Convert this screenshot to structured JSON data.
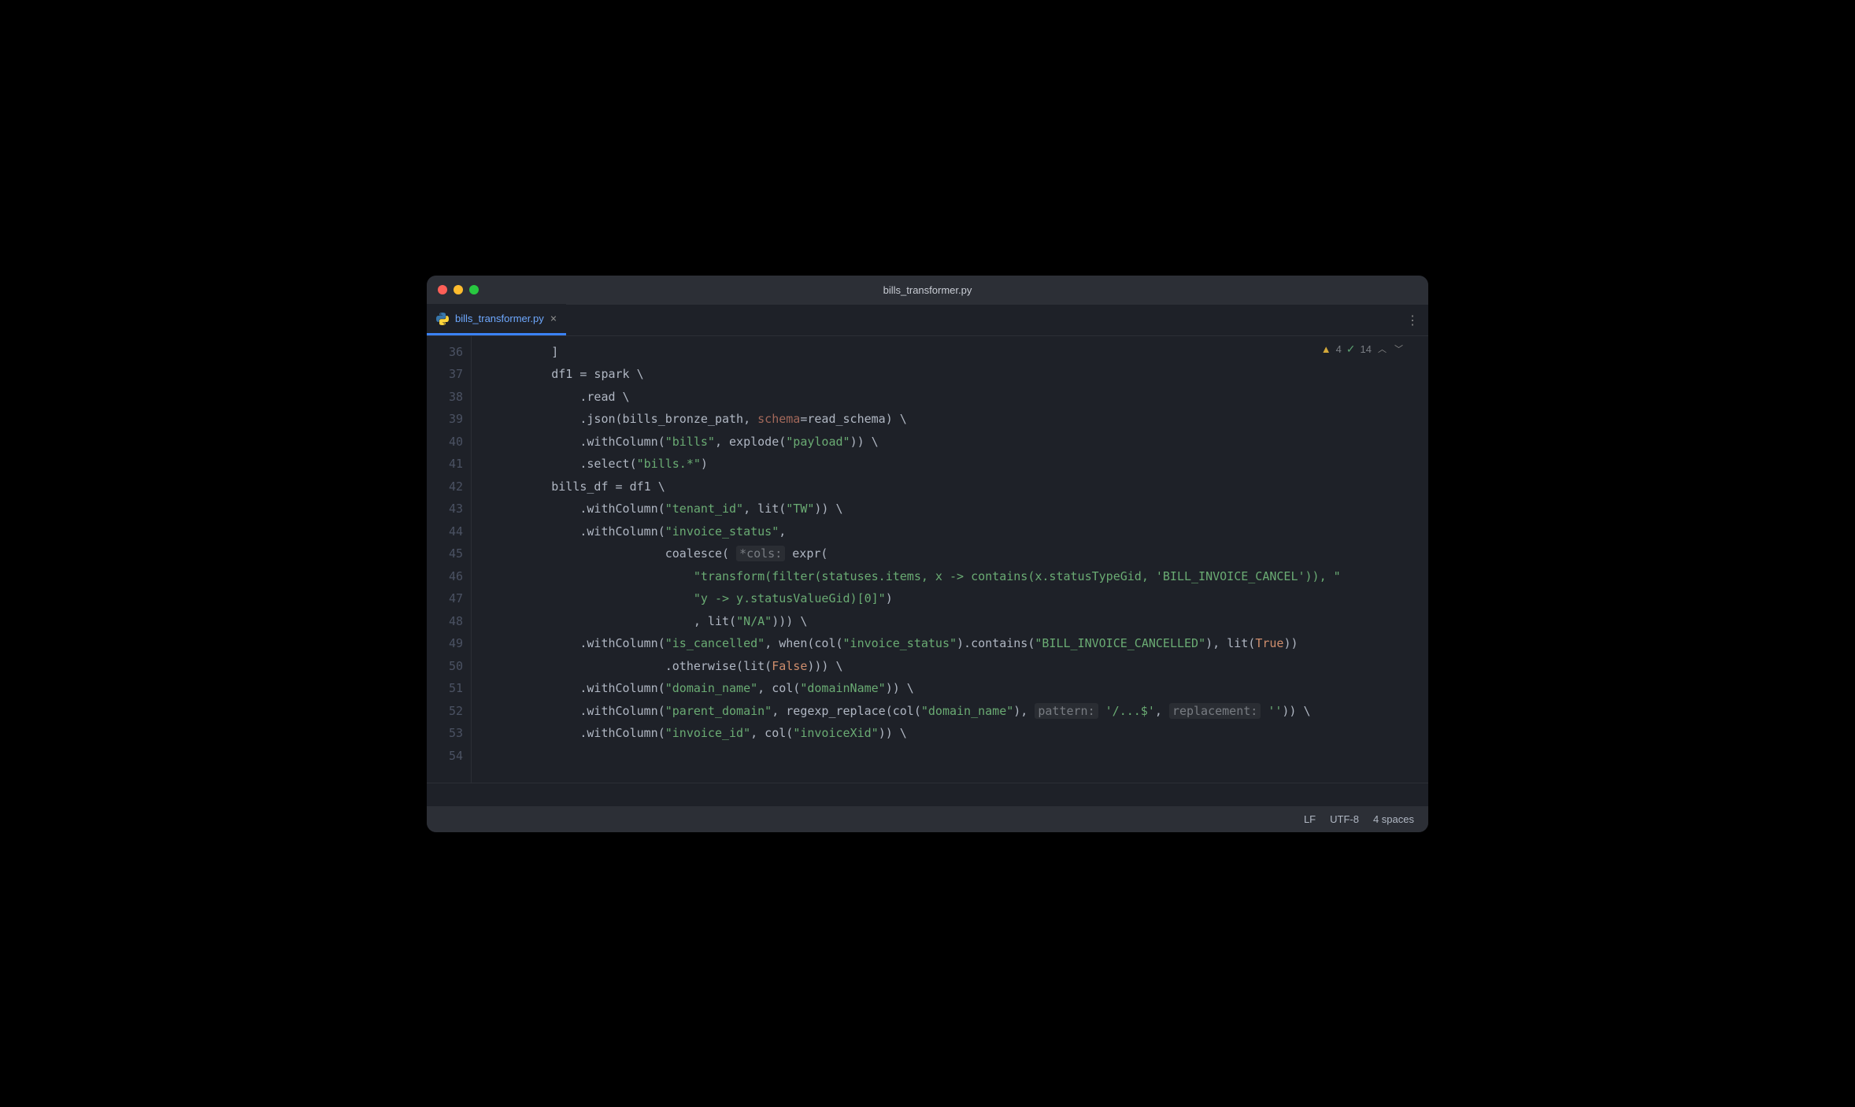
{
  "window": {
    "title": "bills_transformer.py"
  },
  "tab": {
    "label": "bills_transformer.py"
  },
  "inspection": {
    "warnings": "4",
    "weak": "14"
  },
  "statusbar": {
    "linesep": "LF",
    "encoding": "UTF-8",
    "indent": "4 spaces"
  },
  "gutter": [
    "36",
    "37",
    "38",
    "39",
    "40",
    "41",
    "42",
    "43",
    "44",
    "45",
    "46",
    "47",
    "48",
    "49",
    "50",
    "51",
    "52",
    "53",
    "54"
  ],
  "code": {
    "l36": {
      "indent": "        ",
      "tok": [
        {
          "t": "]",
          "c": "op"
        }
      ]
    },
    "l37": {
      "indent": "        ",
      "tok": [
        {
          "t": "df1 = spark \\",
          "c": "id"
        }
      ]
    },
    "l38": {
      "indent": "            ",
      "tok": [
        {
          "t": ".read \\",
          "c": "id"
        }
      ]
    },
    "l39": {
      "indent": "            ",
      "tok": [
        {
          "t": ".json(bills_bronze_path, ",
          "c": "id"
        },
        {
          "t": "schema",
          "c": "kwarg"
        },
        {
          "t": "=read_schema) \\",
          "c": "id"
        }
      ]
    },
    "l40": {
      "indent": "            ",
      "tok": [
        {
          "t": ".withColumn(",
          "c": "id"
        },
        {
          "t": "\"bills\"",
          "c": "str"
        },
        {
          "t": ", explode(",
          "c": "id"
        },
        {
          "t": "\"payload\"",
          "c": "str"
        },
        {
          "t": ")) \\",
          "c": "id"
        }
      ]
    },
    "l41": {
      "indent": "            ",
      "tok": [
        {
          "t": ".select(",
          "c": "id"
        },
        {
          "t": "\"bills.*\"",
          "c": "str"
        },
        {
          "t": ")",
          "c": "id"
        }
      ]
    },
    "l42": {
      "indent": "",
      "tok": []
    },
    "l43": {
      "indent": "        ",
      "tok": [
        {
          "t": "bills_df = df1 \\",
          "c": "id"
        }
      ]
    },
    "l44": {
      "indent": "            ",
      "tok": [
        {
          "t": ".withColumn(",
          "c": "id"
        },
        {
          "t": "\"tenant_id\"",
          "c": "str"
        },
        {
          "t": ", lit(",
          "c": "id"
        },
        {
          "t": "\"TW\"",
          "c": "str"
        },
        {
          "t": ")) \\",
          "c": "id"
        }
      ]
    },
    "l45": {
      "indent": "            ",
      "tok": [
        {
          "t": ".withColumn(",
          "c": "id"
        },
        {
          "t": "\"invoice_status\"",
          "c": "str"
        },
        {
          "t": ",",
          "c": "id"
        }
      ]
    },
    "l46": {
      "indent": "                        ",
      "tok": [
        {
          "t": "coalesce( ",
          "c": "id"
        },
        {
          "t": "*cols:",
          "c": "hint"
        },
        {
          "t": " expr(",
          "c": "id"
        }
      ]
    },
    "l47": {
      "indent": "                            ",
      "tok": [
        {
          "t": "\"transform(filter(statuses.items, x -> contains(x.statusTypeGid, 'BILL_INVOICE_CANCEL')), \"",
          "c": "str"
        }
      ]
    },
    "l48": {
      "indent": "                            ",
      "tok": [
        {
          "t": "\"y -> y.statusValueGid)[0]\"",
          "c": "str"
        },
        {
          "t": ")",
          "c": "id"
        }
      ]
    },
    "l49": {
      "indent": "                            ",
      "tok": [
        {
          "t": ", lit(",
          "c": "id"
        },
        {
          "t": "\"N/A\"",
          "c": "str"
        },
        {
          "t": "))) \\",
          "c": "id"
        }
      ]
    },
    "l50": {
      "indent": "            ",
      "tok": [
        {
          "t": ".withColumn(",
          "c": "id"
        },
        {
          "t": "\"is_cancelled\"",
          "c": "str"
        },
        {
          "t": ", when(col(",
          "c": "id"
        },
        {
          "t": "\"invoice_status\"",
          "c": "str"
        },
        {
          "t": ").contains(",
          "c": "id"
        },
        {
          "t": "\"BILL_INVOICE_CANCELLED\"",
          "c": "str"
        },
        {
          "t": "), lit(",
          "c": "id"
        },
        {
          "t": "True",
          "c": "bool"
        },
        {
          "t": "))",
          "c": "id"
        }
      ]
    },
    "l51": {
      "indent": "                        ",
      "tok": [
        {
          "t": ".otherwise(lit(",
          "c": "id"
        },
        {
          "t": "False",
          "c": "bool"
        },
        {
          "t": "))) \\",
          "c": "id"
        }
      ]
    },
    "l52": {
      "indent": "            ",
      "tok": [
        {
          "t": ".withColumn(",
          "c": "id"
        },
        {
          "t": "\"domain_name\"",
          "c": "str"
        },
        {
          "t": ", col(",
          "c": "id"
        },
        {
          "t": "\"domainName\"",
          "c": "str"
        },
        {
          "t": ")) \\",
          "c": "id"
        }
      ]
    },
    "l53": {
      "indent": "            ",
      "tok": [
        {
          "t": ".withColumn(",
          "c": "id"
        },
        {
          "t": "\"parent_domain\"",
          "c": "str"
        },
        {
          "t": ", regexp_replace(col(",
          "c": "id"
        },
        {
          "t": "\"domain_name\"",
          "c": "str"
        },
        {
          "t": "), ",
          "c": "id"
        },
        {
          "t": "pattern:",
          "c": "hint"
        },
        {
          "t": " ",
          "c": "id"
        },
        {
          "t": "'/...$'",
          "c": "str"
        },
        {
          "t": ", ",
          "c": "id"
        },
        {
          "t": "replacement:",
          "c": "hint"
        },
        {
          "t": " ",
          "c": "id"
        },
        {
          "t": "''",
          "c": "str"
        },
        {
          "t": ")) \\",
          "c": "id"
        }
      ]
    },
    "l54": {
      "indent": "            ",
      "tok": [
        {
          "t": ".withColumn(",
          "c": "id"
        },
        {
          "t": "\"invoice_id\"",
          "c": "str"
        },
        {
          "t": ", col(",
          "c": "id"
        },
        {
          "t": "\"invoiceXid\"",
          "c": "str"
        },
        {
          "t": ")) \\",
          "c": "id"
        }
      ]
    }
  }
}
